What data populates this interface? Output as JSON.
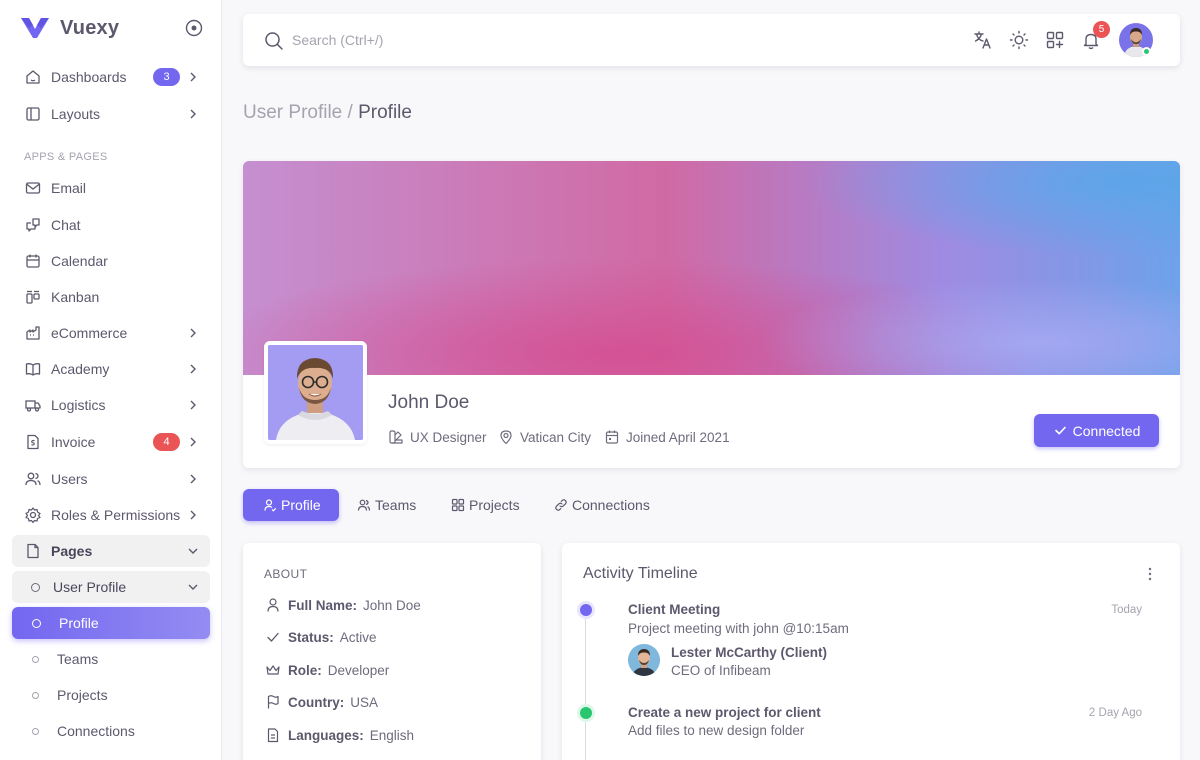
{
  "brand": {
    "name": "Vuexy",
    "color": "#7367f0"
  },
  "sidebar": {
    "section_title": "APPS & PAGES",
    "items": [
      {
        "label": "Dashboards",
        "icon": "smart-home-icon",
        "badge": "3"
      },
      {
        "label": "Layouts",
        "icon": "layout-sidebar-icon"
      },
      {
        "label": "Email",
        "icon": "mail-icon"
      },
      {
        "label": "Chat",
        "icon": "messages-icon"
      },
      {
        "label": "Calendar",
        "icon": "calendar-icon"
      },
      {
        "label": "Kanban",
        "icon": "layout-kanban-icon"
      },
      {
        "label": "eCommerce",
        "icon": "shopping-cart-icon"
      },
      {
        "label": "Academy",
        "icon": "book-icon"
      },
      {
        "label": "Logistics",
        "icon": "truck-icon"
      },
      {
        "label": "Invoice",
        "icon": "file-dollar-icon",
        "badge": "4"
      },
      {
        "label": "Users",
        "icon": "users-icon"
      },
      {
        "label": "Roles & Permissions",
        "icon": "settings-icon"
      },
      {
        "label": "Pages",
        "icon": "file-icon"
      },
      {
        "label": "User Profile",
        "icon": "circle-icon"
      },
      {
        "label": "Profile",
        "icon": "circle-icon"
      },
      {
        "label": "Teams",
        "icon": "circle-icon"
      },
      {
        "label": "Projects",
        "icon": "circle-icon"
      },
      {
        "label": "Connections",
        "icon": "circle-icon"
      }
    ]
  },
  "topbar": {
    "search_placeholder": "Search (Ctrl+/)",
    "notification_count": "5"
  },
  "breadcrumb": {
    "parent": "User Profile",
    "separator": " / ",
    "current": "Profile"
  },
  "profile": {
    "name": "John Doe",
    "designation": "UX Designer",
    "location": "Vatican City",
    "joined": "Joined April 2021",
    "connected_label": "Connected"
  },
  "tabs": [
    {
      "label": "Profile",
      "active": true
    },
    {
      "label": "Teams"
    },
    {
      "label": "Projects"
    },
    {
      "label": "Connections"
    }
  ],
  "about": {
    "title": "ABOUT",
    "rows": [
      {
        "key": "Full Name:",
        "value": "John Doe"
      },
      {
        "key": "Status:",
        "value": "Active"
      },
      {
        "key": "Role:",
        "value": "Developer"
      },
      {
        "key": "Country:",
        "value": "USA"
      },
      {
        "key": "Languages:",
        "value": "English"
      }
    ]
  },
  "timeline": {
    "title": "Activity Timeline",
    "events": [
      {
        "title": "Client Meeting",
        "text": "Project meeting with john @10:15am",
        "time": "Today",
        "color": "#7367f0",
        "person": "Lester McCarthy (Client)",
        "role": "CEO of Infibeam"
      },
      {
        "title": "Create a new project for client",
        "text": "Add files to new design folder",
        "time": "2 Day Ago",
        "color": "#28c76f"
      }
    ]
  },
  "colors": {
    "primary": "#7367f0",
    "danger": "#ea5455",
    "success": "#28c76f"
  }
}
